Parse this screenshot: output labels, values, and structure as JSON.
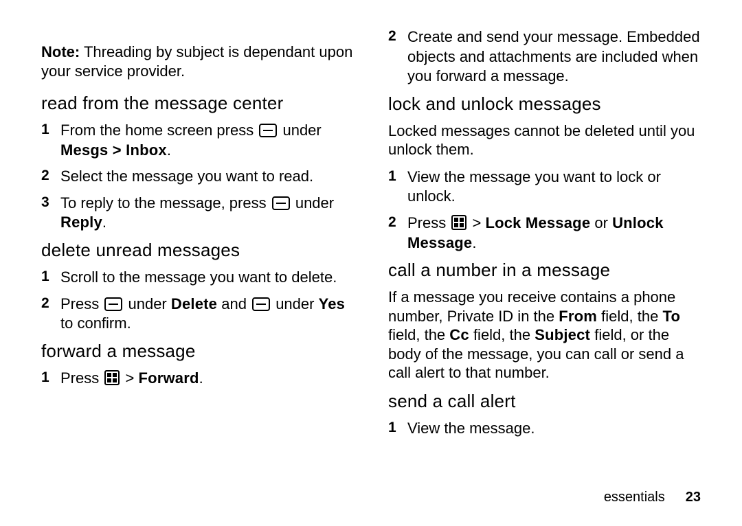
{
  "note": {
    "label": "Note:",
    "text": "Threading by subject is dependant upon your service provider."
  },
  "sections": {
    "read_center": {
      "title": "read from the message center",
      "steps": [
        {
          "pre": "From the home screen press ",
          "icon": "softkey",
          "post": " under ",
          "bold": "Mesgs > Inbox",
          "tail": "."
        },
        {
          "plain": "Select the message you want to read."
        },
        {
          "pre": "To reply to the message, press ",
          "icon": "softkey",
          "post": " under ",
          "bold": "Reply",
          "tail": "."
        }
      ]
    },
    "delete_unread": {
      "title": "delete unread messages",
      "steps": [
        {
          "plain": "Scroll to the message you want to delete."
        },
        {
          "pre": "Press ",
          "icon": "softkey",
          "mid1": " under ",
          "bold1": "Delete",
          "mid2": " and ",
          "icon2": "softkey",
          "mid3": " under ",
          "bold2": "Yes",
          "tail": " to confirm."
        }
      ]
    },
    "forward": {
      "title": "forward a message",
      "steps": [
        {
          "pre": "Press ",
          "icon": "menu",
          "mid": " > ",
          "bold": "Forward",
          "tail": "."
        },
        {
          "plain": "Create and send your message. Embedded objects and attachments are included when you forward a message."
        }
      ]
    },
    "lock": {
      "title": "lock and unlock messages",
      "intro": "Locked messages cannot be deleted until you unlock them.",
      "steps": [
        {
          "plain": "View the message you want to lock or unlock."
        },
        {
          "pre": "Press ",
          "icon": "menu",
          "mid": " > ",
          "bold1": "Lock Message",
          "or": " or ",
          "bold2": "Unlock Message",
          "tail": "."
        }
      ]
    },
    "call_number": {
      "title": "call a number in a message",
      "intro_parts": {
        "p0": "If a message you receive contains a phone number, Private ID in the ",
        "b0": "From",
        "p1": " field, the ",
        "b1": "To",
        "p2": " field, the ",
        "b2": "Cc",
        "p3": " field, the ",
        "b3": "Subject",
        "p4": " field, or the body of the message, you can call or send a call alert to that number."
      }
    },
    "send_alert": {
      "title": "send a call alert",
      "steps": [
        {
          "plain": "View the message."
        }
      ]
    }
  },
  "footer": {
    "section_label": "essentials",
    "page_number": "23"
  },
  "icons": {
    "softkey": "softkey-icon",
    "menu": "menu-icon"
  }
}
